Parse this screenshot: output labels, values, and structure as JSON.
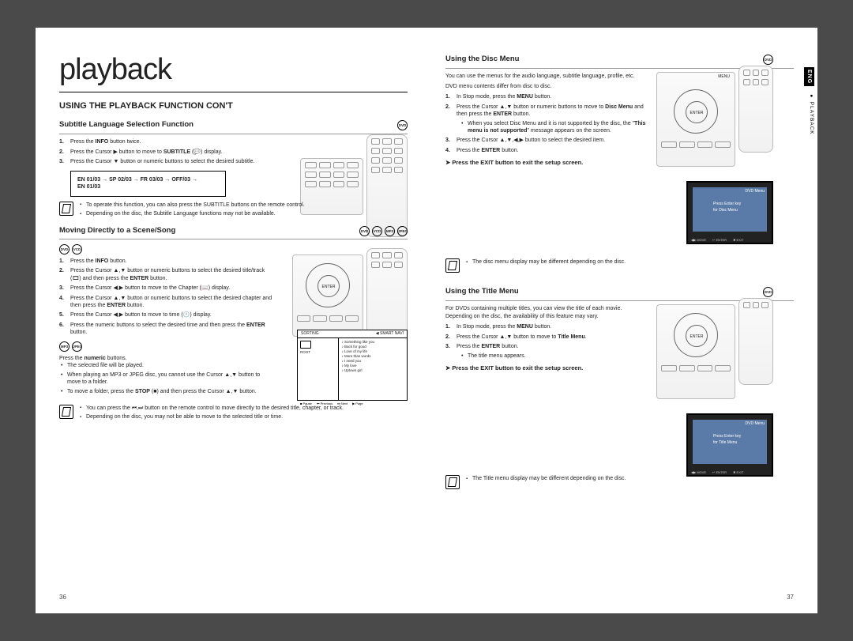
{
  "chapter_title": "playback",
  "side_tab": {
    "lang": "ENG",
    "section_marker": "● PLAYBACK"
  },
  "page_numbers": {
    "left": "36",
    "right": "37"
  },
  "left": {
    "heading": "USING THE PLAYBACK FUNCTION CON'T",
    "sec1": {
      "title": "Subtitle Language Selection Function",
      "badge": "DVD",
      "steps": [
        {
          "pre": "Press the ",
          "bold": "INFO",
          "post": " button twice."
        },
        {
          "pre": "Press the Cursor ▶ button to move to ",
          "bold": "SUBTITLE",
          "post": " (💬) display."
        },
        {
          "pre": "Press the Cursor ▼ button or numeric buttons to select the desired subtitle.",
          "bold": "",
          "post": ""
        }
      ],
      "sequence": [
        "EN 01/03",
        "SP 02/03",
        "FR 03/03",
        "OFF/03",
        "EN 01/03"
      ],
      "notes": [
        "To operate this function, you can also press the SUBTITLE buttons on the remote control.",
        "Depending on the disc, the Subtitle Language functions may not be available."
      ]
    },
    "sec2": {
      "title": "Moving Directly to a Scene/Song",
      "badges_top": [
        "DVD",
        "VCD",
        "MP3",
        "JPEG"
      ],
      "badges_sub1": [
        "DVD",
        "VCD"
      ],
      "steps1": [
        {
          "text": "Press the <b>INFO</b> button."
        },
        {
          "text": "Press the Cursor ▲,▼ button or numeric buttons to select the desired title/track (🎞) and then press the <b>ENTER</b> button."
        },
        {
          "text": "Press the Cursor ◀,▶ button to move to the Chapter (📖) display."
        },
        {
          "text": "Press the Cursor ▲,▼ button or numeric buttons to select the desired chapter and then press the <b>ENTER</b> button."
        },
        {
          "text": "Press the Cursor ◀,▶ button to move to time (🕐) display."
        },
        {
          "text": "Press the numeric buttons to select the desired time and then press the <b>ENTER</b> button."
        }
      ],
      "badges_sub2": [
        "MP3",
        "JPEG"
      ],
      "para2_lead": "Press the <b>numeric</b> buttons.",
      "bullets2": [
        "The selected file will be played.",
        "When playing an MP3 or JPEG disc, you cannot use the Cursor ▲,▼ button to move to a folder.",
        "To move a folder, press the <b>STOP</b> (■) and then press the Cursor ▲,▼ button."
      ],
      "panel": {
        "hdr_left": "SORTING",
        "hdr_right": "◀ SMART NAVI",
        "folder": "ROOT",
        "files": [
          "Something like you",
          "Back for good",
          "Love of my life",
          "More than words",
          "I need you",
          "My love",
          "Uptown girl"
        ],
        "ftr": [
          "■ Pause",
          "⏮ Previous",
          "⏭ Next",
          "▶ Page"
        ]
      },
      "notes": [
        "You can press the ⏮,⏭ button on the remote control to move directly to the desired title, chapter, or track.",
        "Depending on the disc, you may not be able to move to the selected title or time."
      ]
    }
  },
  "right": {
    "sec1": {
      "title": "Using the Disc Menu",
      "badge": "DVD",
      "intro1": "You can use the menus for the audio language, subtitle language, profile, etc.",
      "intro2": "DVD menu contents differ from disc to disc.",
      "steps": [
        {
          "text": "In Stop mode, press the <b>MENU</b> button."
        },
        {
          "text": "Press the Cursor ▲,▼ button or numeric buttons to move to <b>Disc Menu</b> and then press the <b>ENTER</b> button."
        },
        {
          "bullet": "When you select Disc Menu and it is not supported by the disc, the \"<b>This menu is not supported</b>\" message appears on the screen."
        },
        {
          "text": "Press the Cursor ▲,▼,◀,▶ button to select the desired item."
        },
        {
          "text": "Press the <b>ENTER</b> button."
        }
      ],
      "exit": "Press the EXIT button to exit the setup screen.",
      "notes": [
        "The disc menu display may be different depending on the disc."
      ],
      "tv": {
        "title": "DVD Menu",
        "line1": "Press Enter key",
        "line2": "for Disc Menu",
        "ftr": [
          "◀▶ MOVE",
          "↵ ENTER",
          "✖ EXIT"
        ]
      },
      "remote_label": "MENU",
      "enter_label": "ENTER"
    },
    "sec2": {
      "title": "Using the Title Menu",
      "badge": "DVD",
      "intro": "For DVDs containing multiple titles, you can view the title of each movie. Depending on the disc, the availability of this feature may vary.",
      "steps": [
        {
          "text": "In Stop mode, press the <b>MENU</b> button."
        },
        {
          "text": "Press the Cursor ▲,▼ button to move to <b>Title Menu</b>."
        },
        {
          "text": "Press the <b>ENTER</b> button."
        },
        {
          "bullet": "The title menu appears."
        }
      ],
      "exit": "Press the EXIT button to exit the setup screen.",
      "notes": [
        "The Title menu display may be different depending on the disc."
      ],
      "tv": {
        "title": "DVD Menu",
        "line1": "Press Enter key",
        "line2": "for Title Menu",
        "ftr": [
          "◀▶ MOVE",
          "↵ ENTER",
          "✖ EXIT"
        ]
      }
    }
  }
}
